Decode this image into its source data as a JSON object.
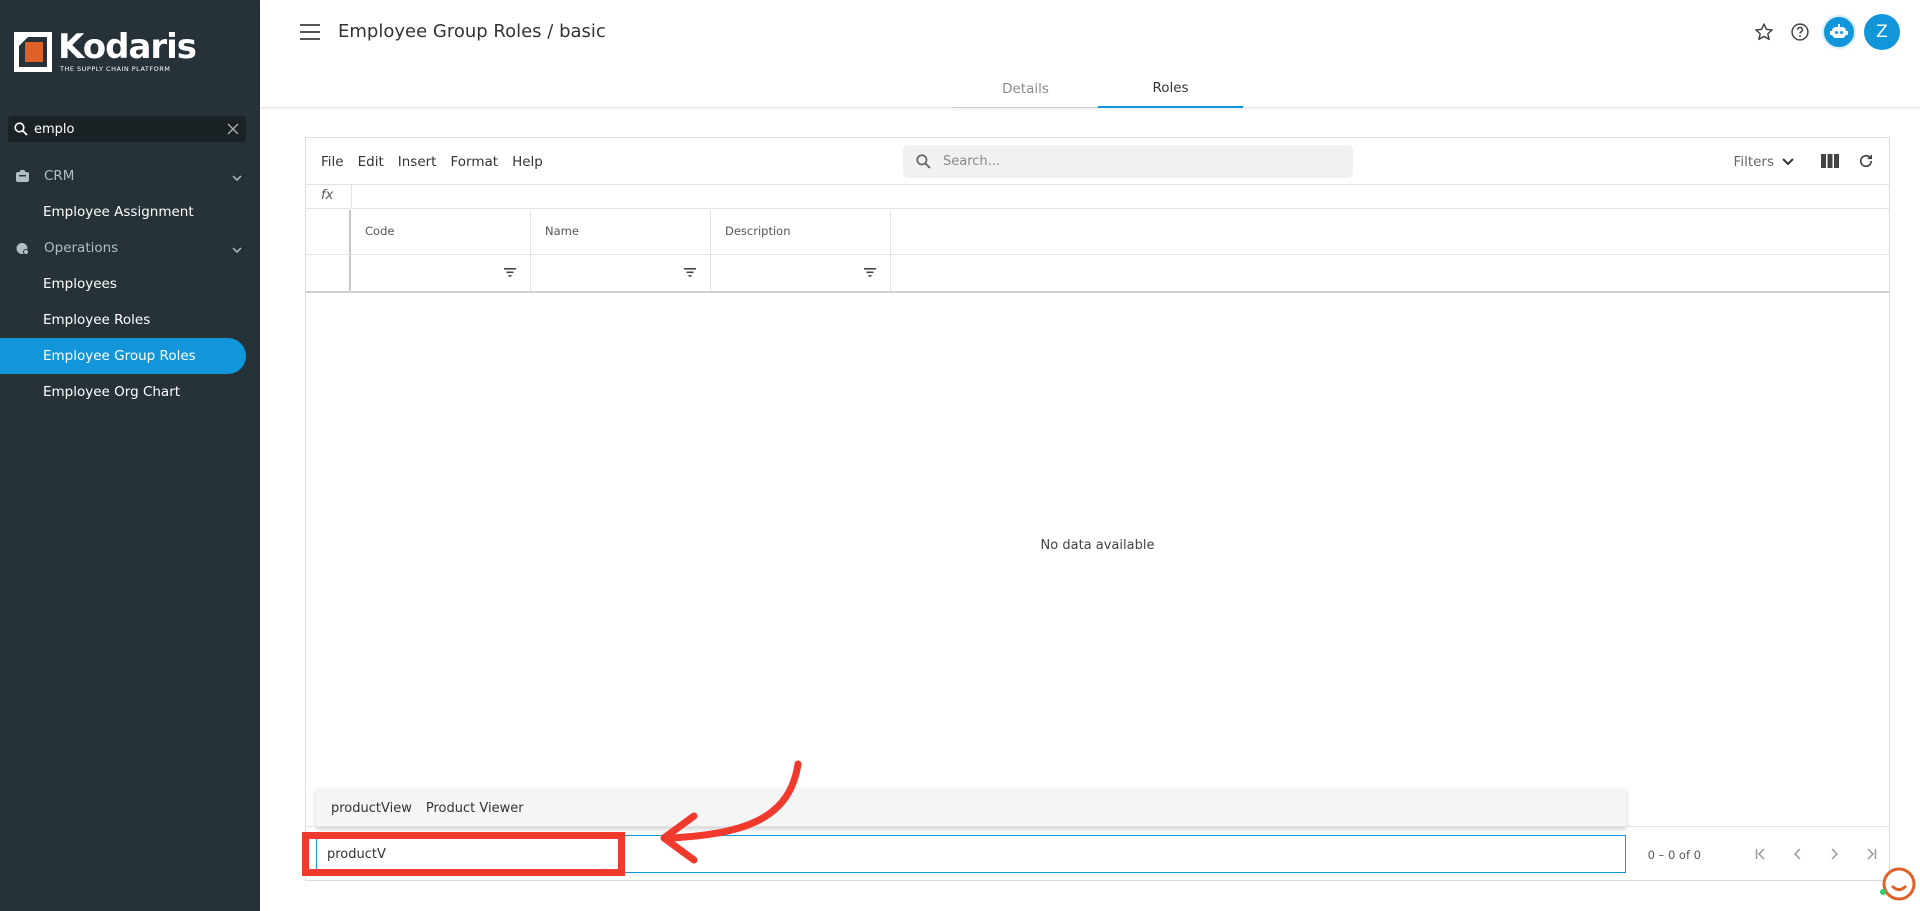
{
  "brand": {
    "name": "Kodaris",
    "tagline": "THE SUPPLY CHAIN PLATFORM"
  },
  "sidebar": {
    "search": {
      "value": "emplo"
    },
    "groups": [
      {
        "label": "CRM",
        "icon": "crm-icon",
        "items": [
          {
            "label": "Employee Assignment"
          }
        ]
      },
      {
        "label": "Operations",
        "icon": "operations-icon",
        "items": [
          {
            "label": "Employees"
          },
          {
            "label": "Employee Roles"
          },
          {
            "label": "Employee Group Roles",
            "active": true
          },
          {
            "label": "Employee Org Chart"
          }
        ]
      }
    ]
  },
  "header": {
    "title": "Employee Group Roles / basic",
    "avatar_letter": "Z",
    "tabs": [
      {
        "label": "Details"
      },
      {
        "label": "Roles",
        "active": true
      }
    ]
  },
  "grid": {
    "menu": [
      "File",
      "Edit",
      "Insert",
      "Format",
      "Help"
    ],
    "search_placeholder": "Search...",
    "filters_label": "Filters",
    "fx_label": "fx",
    "columns": [
      "Code",
      "Name",
      "Description"
    ],
    "empty_text": "No data available",
    "autocomplete": {
      "code": "productView",
      "name": "Product Viewer"
    },
    "edit_value": "productV",
    "pager_count": "0 – 0 of 0"
  },
  "colors": {
    "accent": "#1196d9",
    "sidebar_bg": "#263238",
    "annotation": "#f03a2e"
  }
}
